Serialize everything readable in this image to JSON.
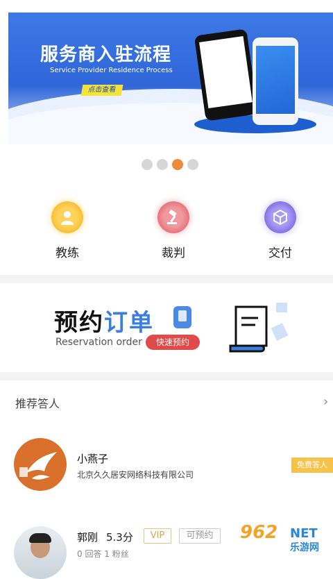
{
  "banner": {
    "title": "服务商入驻流程",
    "subtitle": "Service Provider Residence Process",
    "button": "点击查看"
  },
  "carousel": {
    "count": 4,
    "active_index": 2
  },
  "roles": [
    {
      "label": "教练",
      "icon": "coach-person-icon"
    },
    {
      "label": "裁判",
      "icon": "referee-gavel-icon"
    },
    {
      "label": "交付",
      "icon": "delivery-box-icon"
    }
  ],
  "reservation": {
    "title_black": "预约",
    "title_blue": "订单",
    "english": "Reservation order",
    "button": "快速预约"
  },
  "recommend": {
    "title": "推荐答人",
    "people": [
      {
        "name": "小燕子",
        "company": "北京久久居安网络科技有限公司",
        "badge": "免费答人"
      },
      {
        "name": "郭刚",
        "score": "5.3分",
        "vip": "VIP",
        "status": "可预约",
        "stats": "0 回答   1 粉丝"
      }
    ]
  },
  "watermark": {
    "number": "962",
    "net": "NET",
    "cn": "乐游网"
  }
}
